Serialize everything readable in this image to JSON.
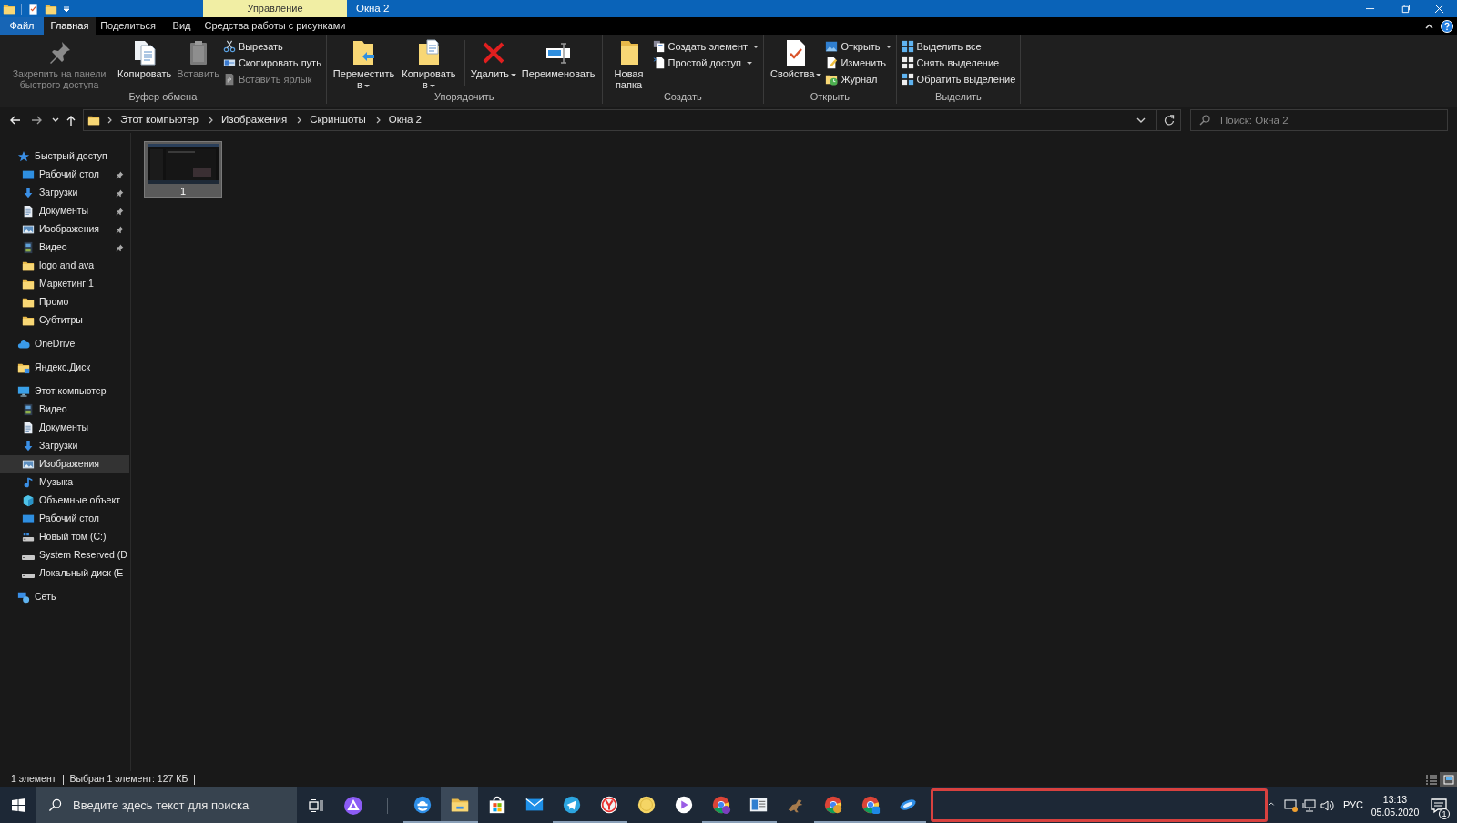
{
  "window": {
    "title": "Окна 2",
    "context_tab": "Управление"
  },
  "ribbon_tabs": [
    {
      "label": "Файл",
      "kind": "file",
      "selected": false
    },
    {
      "label": "Главная",
      "kind": "tab",
      "selected": true
    },
    {
      "label": "Поделиться",
      "kind": "tab",
      "selected": false
    },
    {
      "label": "Вид",
      "kind": "tab",
      "selected": false
    },
    {
      "label": "Средства работы с рисунками",
      "kind": "tab",
      "selected": false
    }
  ],
  "ribbon_groups": [
    {
      "label": "Буфер обмена",
      "items": [
        {
          "kind": "large",
          "label": "Закрепить на панели быстрого доступа",
          "disabled": true,
          "dropdown": false
        },
        {
          "kind": "large",
          "label": "Копировать",
          "disabled": false,
          "dropdown": false
        },
        {
          "kind": "large",
          "label": "Вставить",
          "disabled": true,
          "dropdown": false
        },
        {
          "kind": "column",
          "items": [
            {
              "label": "Вырезать",
              "disabled": false,
              "dropdown": false
            },
            {
              "label": "Скопировать путь",
              "disabled": false,
              "dropdown": false
            },
            {
              "label": "Вставить ярлык",
              "disabled": true,
              "dropdown": false
            }
          ]
        }
      ]
    },
    {
      "label": "Упорядочить",
      "items": [
        {
          "kind": "large",
          "label": "Переместить в",
          "disabled": false,
          "dropdown": true
        },
        {
          "kind": "large",
          "label": "Копировать в",
          "disabled": false,
          "dropdown": true
        },
        {
          "kind": "separator"
        },
        {
          "kind": "large",
          "label": "Удалить",
          "disabled": false,
          "dropdown": true
        },
        {
          "kind": "large",
          "label": "Переименовать",
          "disabled": false,
          "dropdown": false
        }
      ]
    },
    {
      "label": "Создать",
      "items": [
        {
          "kind": "large",
          "label": "Новая папка",
          "disabled": false,
          "dropdown": false
        },
        {
          "kind": "column",
          "items": [
            {
              "label": "Создать элемент",
              "disabled": false,
              "dropdown": true
            },
            {
              "label": "Простой доступ",
              "disabled": false,
              "dropdown": true
            }
          ]
        }
      ]
    },
    {
      "label": "Открыть",
      "items": [
        {
          "kind": "large",
          "label": "Свойства",
          "disabled": false,
          "dropdown": true
        },
        {
          "kind": "column",
          "items": [
            {
              "label": "Открыть",
              "disabled": false,
              "dropdown": true
            },
            {
              "label": "Изменить",
              "disabled": false,
              "dropdown": false
            },
            {
              "label": "Журнал",
              "disabled": false,
              "dropdown": false
            }
          ]
        }
      ]
    },
    {
      "label": "Выделить",
      "items": [
        {
          "kind": "column",
          "items": [
            {
              "label": "Выделить все",
              "disabled": false,
              "dropdown": false
            },
            {
              "label": "Снять выделение",
              "disabled": false,
              "dropdown": false
            },
            {
              "label": "Обратить выделение",
              "disabled": false,
              "dropdown": false
            }
          ]
        }
      ]
    }
  ],
  "address_bar": {
    "path": [
      "Этот компьютер",
      "Изображения",
      "Скриншоты",
      "Окна 2"
    ],
    "search_placeholder": "Поиск: Окна 2"
  },
  "sidebar": {
    "items": [
      {
        "label": "Быстрый доступ",
        "kind": "star",
        "selected": false,
        "children": [
          {
            "label": "Рабочий стол",
            "kind": "desktop",
            "selected": false,
            "pinned": true
          },
          {
            "label": "Загрузки",
            "kind": "downloads",
            "selected": false,
            "pinned": true
          },
          {
            "label": "Документы",
            "kind": "documents",
            "selected": false,
            "pinned": true
          },
          {
            "label": "Изображения",
            "kind": "pictures",
            "selected": false,
            "pinned": true
          },
          {
            "label": "Видео",
            "kind": "video",
            "selected": false,
            "pinned": true
          },
          {
            "label": "logo and ava",
            "kind": "folder",
            "selected": false,
            "pinned": false
          },
          {
            "label": "Маркетинг 1",
            "kind": "folder",
            "selected": false,
            "pinned": false
          },
          {
            "label": "Промо",
            "kind": "folder",
            "selected": false,
            "pinned": false
          },
          {
            "label": "Субтитры",
            "kind": "folder",
            "selected": false,
            "pinned": false
          }
        ]
      },
      {
        "label": "OneDrive",
        "kind": "cloud",
        "selected": false
      },
      {
        "label": "Яндекс.Диск",
        "kind": "yandex_disk",
        "selected": false
      },
      {
        "label": "Этот компьютер",
        "kind": "computer",
        "selected": false,
        "children": [
          {
            "label": "Видео",
            "kind": "video",
            "selected": false
          },
          {
            "label": "Документы",
            "kind": "documents",
            "selected": false
          },
          {
            "label": "Загрузки",
            "kind": "downloads",
            "selected": false
          },
          {
            "label": "Изображения",
            "kind": "pictures",
            "selected": true
          },
          {
            "label": "Музыка",
            "kind": "music",
            "selected": false
          },
          {
            "label": "Объемные объект",
            "kind": "objects3d",
            "selected": false
          },
          {
            "label": "Рабочий стол",
            "kind": "desktop",
            "selected": false
          },
          {
            "label": "Новый том (C:)",
            "kind": "system_drive",
            "selected": false
          },
          {
            "label": "System Reserved (D",
            "kind": "drive",
            "selected": false
          },
          {
            "label": "Локальный диск (E",
            "kind": "drive",
            "selected": false
          }
        ]
      },
      {
        "label": "Сеть",
        "kind": "network",
        "selected": false
      }
    ]
  },
  "files": [
    {
      "label": "1",
      "selected": true
    }
  ],
  "status_bar": {
    "items": [
      "1 элемент",
      "Выбран 1 элемент: 127 КБ"
    ],
    "views": [
      {
        "selected": false
      },
      {
        "selected": true
      }
    ]
  },
  "taskbar": {
    "search_placeholder": "Введите здесь текст для поиска",
    "apps": [
      {
        "running": true,
        "active": false
      },
      {
        "running": true,
        "active": true
      },
      {
        "running": false,
        "active": false
      },
      {
        "running": false,
        "active": false
      },
      {
        "running": true,
        "active": false
      },
      {
        "running": true,
        "active": false
      },
      {
        "running": false,
        "active": false
      },
      {
        "running": false,
        "active": false
      },
      {
        "running": true,
        "active": false
      },
      {
        "running": true,
        "active": false
      },
      {
        "running": false,
        "active": false
      },
      {
        "running": true,
        "active": false
      },
      {
        "running": true,
        "active": false
      },
      {
        "running": true,
        "active": false
      }
    ],
    "language": "РУС",
    "time": "13:13",
    "date": "05.05.2020",
    "notifications": "1"
  }
}
